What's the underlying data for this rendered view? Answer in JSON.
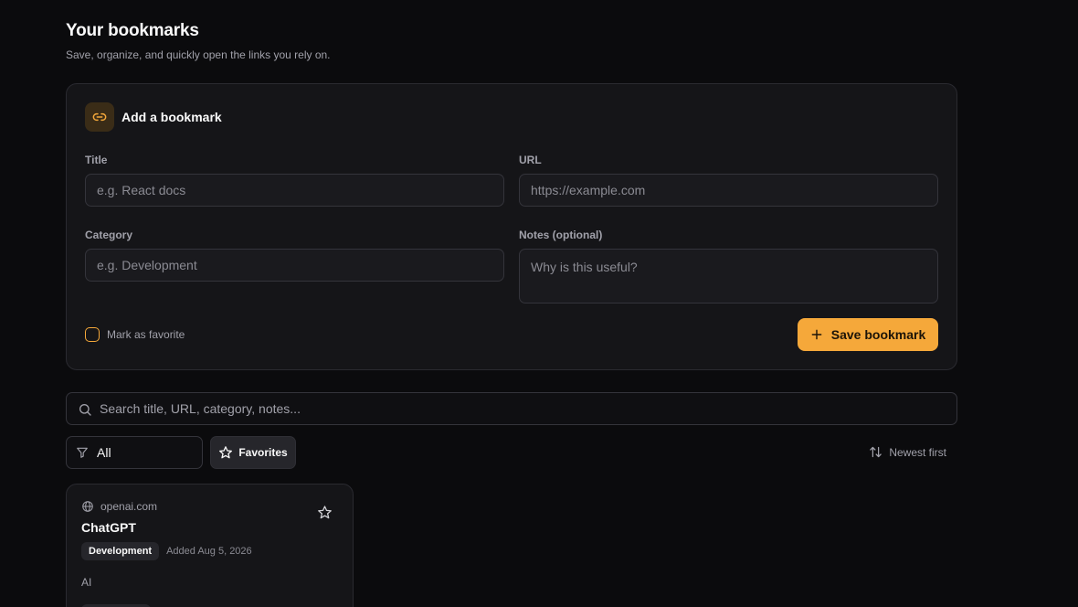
{
  "header": {
    "title": "Your bookmarks",
    "subtitle": "Save, organize, and quickly open the links you rely on."
  },
  "add_form": {
    "heading": "Add a bookmark",
    "icon": "link-icon",
    "title_label": "Title",
    "title_placeholder": "e.g. React docs",
    "url_label": "URL",
    "url_placeholder": "https://example.com",
    "category_label": "Category",
    "category_placeholder": "e.g. Development",
    "notes_label": "Notes (optional)",
    "notes_placeholder": "Why is this useful?",
    "favorite_label": "Mark as favorite",
    "favorite_checked": false,
    "save_label": "Save bookmark"
  },
  "toolbar": {
    "search_placeholder": "Search title, URL, category, notes...",
    "filter_value": "All",
    "favorites_label": "Favorites",
    "sort_label": "Newest first"
  },
  "bookmarks": [
    {
      "domain": "openai.com",
      "title": "ChatGPT",
      "category": "Development",
      "added": "Added Aug 5, 2026",
      "notes": "AI",
      "favorite": false
    }
  ],
  "colors": {
    "accent": "#f5a83a",
    "background": "#0b0b0d",
    "card": "#151518",
    "border": "#2a2a30"
  }
}
